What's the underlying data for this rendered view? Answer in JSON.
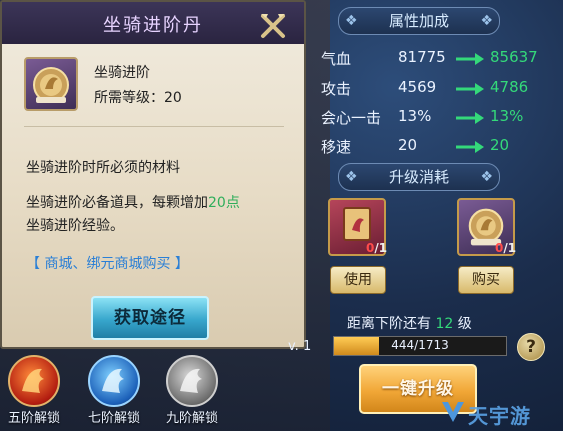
{
  "tooltip": {
    "title": "坐骑进阶丹",
    "item_name": "坐骑进阶",
    "required_level": "所需等级：20",
    "description_line1": "坐骑进阶时所必须的材料",
    "description_line2_prefix": "坐骑进阶必备道具，每颗增加",
    "description_line2_highlight": "20点",
    "description_line3": "坐骑进阶经验。",
    "shop_link": "【 商城、绑元商城购买 】",
    "get_source_button": "获取途径"
  },
  "attributes": {
    "header": "属性加成",
    "rows": [
      {
        "label": "气血",
        "current": "81775",
        "next": "85637"
      },
      {
        "label": "攻击",
        "current": "4569",
        "next": "4786"
      },
      {
        "label": "会心一击",
        "current": "13%",
        "next": "13%"
      },
      {
        "label": "移速",
        "current": "20",
        "next": "20"
      }
    ]
  },
  "cost": {
    "header": "升级消耗",
    "items": [
      {
        "have": "0",
        "total": "/1",
        "button": "使用"
      },
      {
        "have": "0",
        "total": "/1",
        "button": "购买"
      }
    ]
  },
  "progress": {
    "remaining_prefix": "距离下阶还有",
    "remaining_levels": "12",
    "remaining_suffix": "级",
    "level_label": "v. 1",
    "text": "444/1713",
    "fraction": 0.259,
    "help": "?"
  },
  "upgrade_button": "一键升级",
  "unlocks": [
    {
      "label": "五阶解锁"
    },
    {
      "label": "七阶解锁"
    },
    {
      "label": "九阶解锁"
    }
  ],
  "watermark": "天宇游",
  "colors": {
    "positive": "#34d97a",
    "link": "#2a7fd6",
    "warning": "#ff4b4b"
  }
}
